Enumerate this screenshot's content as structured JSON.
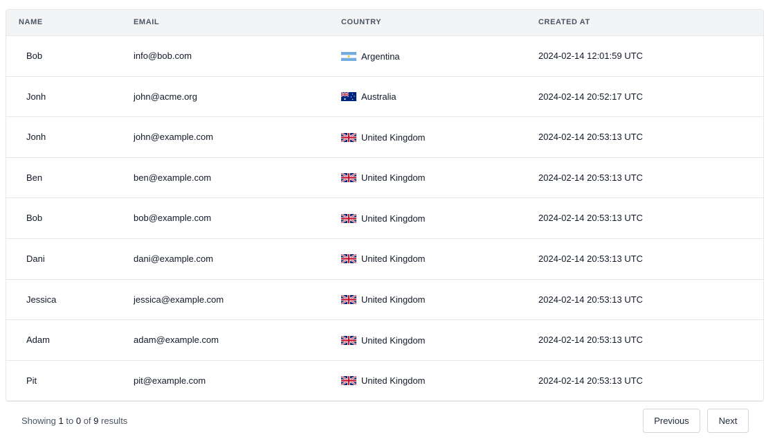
{
  "table": {
    "headers": {
      "name": "NAME",
      "email": "EMAIL",
      "country": "COUNTRY",
      "created_at": "CREATED AT"
    },
    "rows": [
      {
        "name": "Bob",
        "email": "info@bob.com",
        "country": "Argentina",
        "flag": "argentina-flag-icon",
        "created_at": "2024-02-14 12:01:59 UTC"
      },
      {
        "name": "Jonh",
        "email": "john@acme.org",
        "country": "Australia",
        "flag": "australia-flag-icon",
        "created_at": "2024-02-14 20:52:17 UTC"
      },
      {
        "name": "Jonh",
        "email": "john@example.com",
        "country": "United Kingdom",
        "flag": "uk-flag-icon",
        "created_at": "2024-02-14 20:53:13 UTC"
      },
      {
        "name": "Ben",
        "email": "ben@example.com",
        "country": "United Kingdom",
        "flag": "uk-flag-icon",
        "created_at": "2024-02-14 20:53:13 UTC"
      },
      {
        "name": "Bob",
        "email": "bob@example.com",
        "country": "United Kingdom",
        "flag": "uk-flag-icon",
        "created_at": "2024-02-14 20:53:13 UTC"
      },
      {
        "name": "Dani",
        "email": "dani@example.com",
        "country": "United Kingdom",
        "flag": "uk-flag-icon",
        "created_at": "2024-02-14 20:53:13 UTC"
      },
      {
        "name": "Jessica",
        "email": "jessica@example.com",
        "country": "United Kingdom",
        "flag": "uk-flag-icon",
        "created_at": "2024-02-14 20:53:13 UTC"
      },
      {
        "name": "Adam",
        "email": "adam@example.com",
        "country": "United Kingdom",
        "flag": "uk-flag-icon",
        "created_at": "2024-02-14 20:53:13 UTC"
      },
      {
        "name": "Pit",
        "email": "pit@example.com",
        "country": "United Kingdom",
        "flag": "uk-flag-icon",
        "created_at": "2024-02-14 20:53:13 UTC"
      }
    ]
  },
  "pagination": {
    "showing_label": "Showing",
    "from": "1",
    "to_label": "to",
    "to": "0",
    "of_label": "of",
    "total": "9",
    "results_label": "results",
    "previous_label": "Previous",
    "next_label": "Next"
  },
  "colors": {
    "header_bg": "#f3f4f6",
    "border": "#e5e7eb",
    "text": "#111827",
    "muted_text": "#4b5563"
  }
}
